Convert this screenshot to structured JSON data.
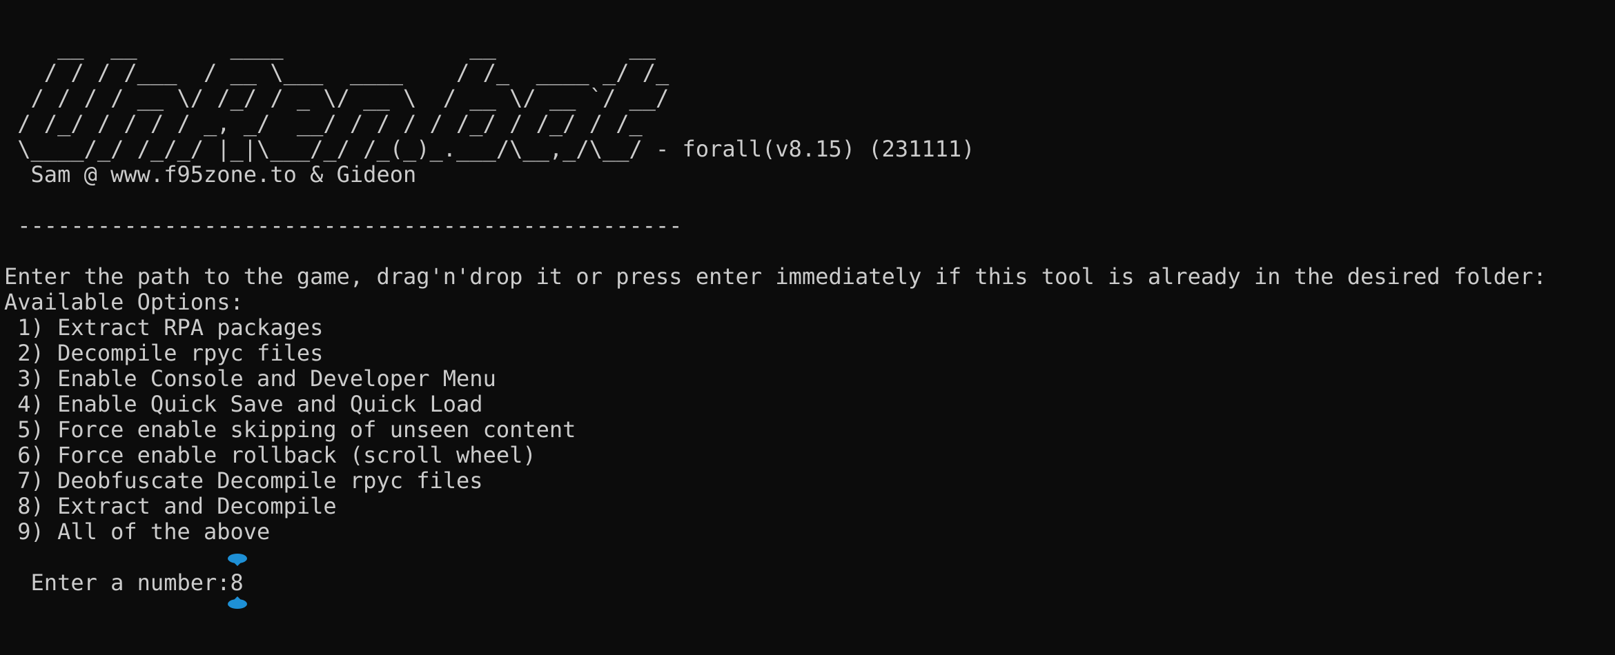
{
  "banner": {
    "lines": [
      "    __  __       ____              __          __",
      "   / / / /___  / __ \\___  ____    / /_  ____ _/ /_",
      "  / / / / __ \\/ /_/ / _ \\/ __ \\  / __ \\/ __ `/ __/",
      " / /_/ / / / / _, _/  __/ / / / / /_/ / /_/ / /_",
      " \\____/_/ /_/_/ |_|\\___/_/ /_(_)_.___/\\__,_/\\__/ - forall(v8.15) (231111)",
      "  Sam @ www.f95zone.to & Gideon"
    ]
  },
  "separator": " --------------------------------------------------",
  "instruction": "Enter the path to the game, drag'n'drop it or press enter immediately if this tool is already in the desired folder:",
  "options_header": "Available Options:",
  "options": [
    " 1) Extract RPA packages",
    " 2) Decompile rpyc files",
    " 3) Enable Console and Developer Menu",
    " 4) Enable Quick Save and Quick Load",
    " 5) Force enable skipping of unseen content",
    " 6) Force enable rollback (scroll wheel)",
    " 7) Deobfuscate Decompile rpyc files",
    " 8) Extract and Decompile",
    " 9) All of the above"
  ],
  "prompt": {
    "label": "  Enter a number:",
    "value": "8"
  },
  "colors": {
    "background": "#0c0c0c",
    "text": "#cccccc",
    "selection_handle": "#1e90d6"
  },
  "icons": {
    "selection_handle": "caret-selection-handle-icon"
  }
}
